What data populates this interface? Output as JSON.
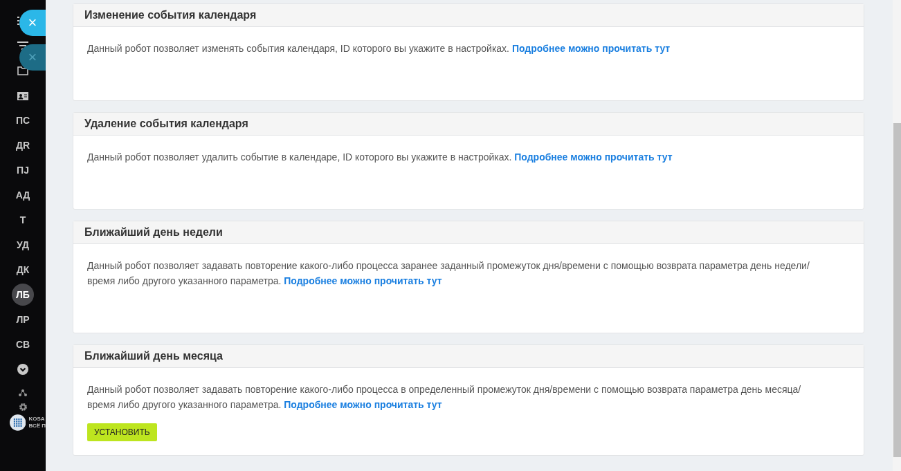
{
  "sidebar": {
    "items": [
      {
        "kind": "menu"
      },
      {
        "kind": "filter"
      },
      {
        "kind": "folder"
      },
      {
        "kind": "contact"
      },
      {
        "kind": "text",
        "label": "ПС",
        "selected": false
      },
      {
        "kind": "text",
        "label": "ДR",
        "selected": false
      },
      {
        "kind": "text",
        "label": "ПЈ",
        "selected": false
      },
      {
        "kind": "text",
        "label": "АД",
        "selected": false
      },
      {
        "kind": "text",
        "label": "Т",
        "selected": false
      },
      {
        "kind": "text",
        "label": "УД",
        "selected": false
      },
      {
        "kind": "text",
        "label": "ДК",
        "selected": false
      },
      {
        "kind": "text",
        "label": "ЛБ",
        "selected": true
      },
      {
        "kind": "text",
        "label": "ЛР",
        "selected": false
      },
      {
        "kind": "text",
        "label": "СВ",
        "selected": false
      },
      {
        "kind": "more"
      }
    ],
    "bottom": [
      {
        "kind": "network"
      },
      {
        "kind": "settings"
      }
    ],
    "brand": {
      "line1": "KOSA",
      "line2": "ВСЁ П"
    }
  },
  "close_buttons": [
    {
      "label": "×",
      "kind": "active"
    },
    {
      "label": "×",
      "kind": "dim"
    }
  ],
  "cards": [
    {
      "title": "Изменение события календаря",
      "text": "Данный робот позволяет изменять события календаря, ID которого вы укажите в настройках.",
      "link": "Подробнее можно прочитать тут"
    },
    {
      "title": "Удаление события календаря",
      "text": "Данный робот позволяет удалить событие в календаре, ID которого вы укажите в настройках.",
      "link": "Подробнее можно прочитать тут"
    },
    {
      "title": "Ближайший день недели",
      "text": "Данный робот позволяет задавать повторение какого-либо процесса заранее заданный промежуток дня/времени с помощью возврата параметра день недели/время либо другого указанного параметра.",
      "link": "Подробнее можно прочитать тут"
    },
    {
      "title": "Ближайший день месяца",
      "text": "Данный робот позволяет задавать повторение какого-либо процесса в определенный промежуток дня/времени с помощью возврата параметра день месяца/время либо другого указанного параметра.",
      "link": "Подробнее можно прочитать тут",
      "button": "УСТАНОВИТЬ"
    }
  ]
}
